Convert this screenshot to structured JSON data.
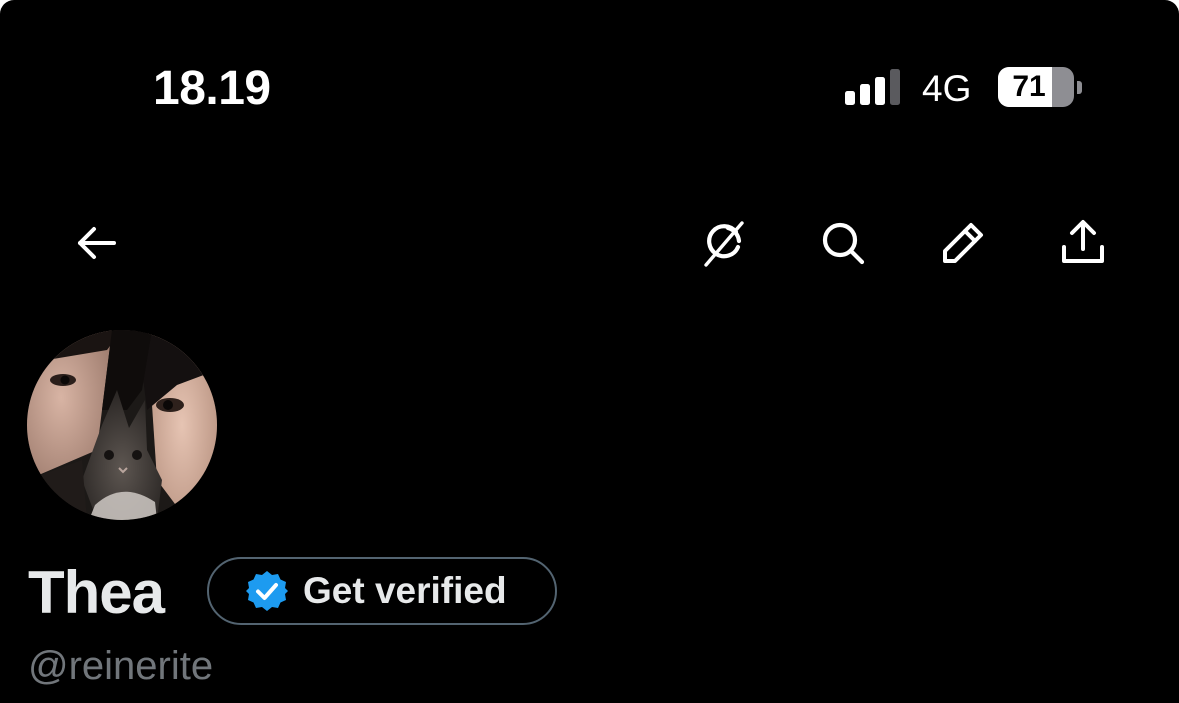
{
  "status_bar": {
    "time": "18.19",
    "network": "4G",
    "battery_level": "71",
    "battery_fraction": 0.71,
    "signal_bars_active": 3,
    "signal_bars_total": 4
  },
  "nav": {
    "back_icon": "arrow-left-icon",
    "grok_icon": "grok-icon",
    "search_icon": "search-icon",
    "edit_icon": "pencil-icon",
    "share_icon": "share-icon"
  },
  "profile": {
    "display_name": "Thea",
    "handle": "@reinerite",
    "verify_label": "Get verified",
    "verify_badge_color": "#1d9bf0"
  },
  "colors": {
    "background": "#000000",
    "text_primary": "#e7e9ea",
    "text_secondary": "#71767b",
    "border": "#536471"
  }
}
